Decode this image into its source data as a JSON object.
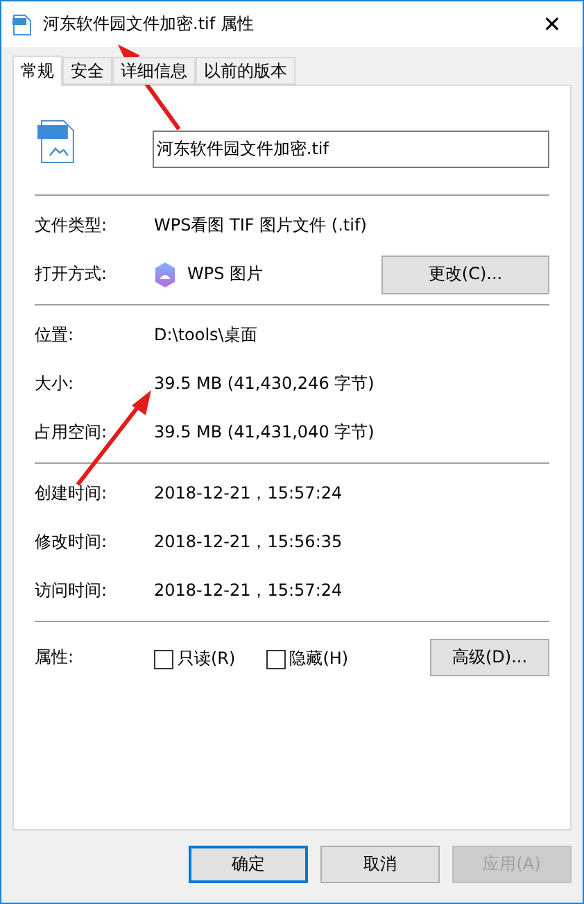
{
  "window": {
    "title": "河东软件园文件加密.tif 属性",
    "close": "✕"
  },
  "tabs": [
    {
      "label": "常规",
      "selected": true
    },
    {
      "label": "安全",
      "selected": false
    },
    {
      "label": "详细信息",
      "selected": false
    },
    {
      "label": "以前的版本",
      "selected": false
    }
  ],
  "file_name": "河东软件园文件加密.tif",
  "sections": [
    [
      {
        "kind": "text",
        "label": "文件类型:",
        "value": "WPS看图 TIF 图片文件 (.tif)"
      },
      {
        "kind": "app",
        "label": "打开方式:",
        "value": "WPS 图片",
        "button": "更改(C)..."
      }
    ],
    [
      {
        "kind": "text",
        "label": "位置:",
        "value": "D:\\tools\\桌面"
      },
      {
        "kind": "text",
        "label": "大小:",
        "value": "39.5 MB (41,430,246 字节)"
      },
      {
        "kind": "text",
        "label": "占用空间:",
        "value": "39.5 MB (41,431,040 字节)"
      }
    ],
    [
      {
        "kind": "text",
        "label": "创建时间:",
        "value": "2018-12-21，15:57:24"
      },
      {
        "kind": "text",
        "label": "修改时间:",
        "value": "2018-12-21，15:56:35"
      },
      {
        "kind": "text",
        "label": "访问时间:",
        "value": "2018-12-21，15:57:24"
      }
    ],
    [
      {
        "kind": "attributes",
        "label": "属性:",
        "checkboxes": [
          {
            "label": "只读(R)",
            "checked": false
          },
          {
            "label": "隐藏(H)",
            "checked": false
          }
        ],
        "button": "高级(D)..."
      }
    ]
  ],
  "buttons": [
    {
      "label": "确定",
      "default": true,
      "disabled": false
    },
    {
      "label": "取消",
      "default": false,
      "disabled": false
    },
    {
      "label": "应用(A)",
      "default": false,
      "disabled": true
    }
  ]
}
